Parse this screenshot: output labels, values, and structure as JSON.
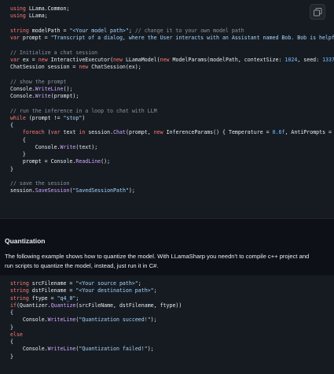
{
  "code_block_1": {
    "copy_label": "copy-icon",
    "lines": [
      [
        {
          "c": "kw",
          "t": "using"
        },
        {
          "c": "tx",
          "t": " LLama.Common;"
        }
      ],
      [
        {
          "c": "kw",
          "t": "using"
        },
        {
          "c": "tx",
          "t": " LLama;"
        }
      ],
      [],
      [
        {
          "c": "kw",
          "t": "string"
        },
        {
          "c": "tx",
          "t": " modelPath = "
        },
        {
          "c": "str",
          "t": "\"<Your model path>\""
        },
        {
          "c": "tx",
          "t": "; "
        },
        {
          "c": "cm",
          "t": "// change it to your own model path"
        }
      ],
      [
        {
          "c": "kw",
          "t": "var"
        },
        {
          "c": "tx",
          "t": " prompt = "
        },
        {
          "c": "str",
          "t": "\"Transcript of a dialog, where the User interacts with an Assistant named Bob. Bob is helpful, k"
        }
      ],
      [],
      [
        {
          "c": "cm",
          "t": "// Initialize a chat session"
        }
      ],
      [
        {
          "c": "kw",
          "t": "var"
        },
        {
          "c": "tx",
          "t": " ex = "
        },
        {
          "c": "kw",
          "t": "new"
        },
        {
          "c": "tx",
          "t": " InteractiveExecutor("
        },
        {
          "c": "kw",
          "t": "new"
        },
        {
          "c": "tx",
          "t": " LLamaModel("
        },
        {
          "c": "kw",
          "t": "new"
        },
        {
          "c": "tx",
          "t": " ModelParams(modelPath, contextSize: "
        },
        {
          "c": "num",
          "t": "1024"
        },
        {
          "c": "tx",
          "t": ", seed: "
        },
        {
          "c": "num",
          "t": "1337"
        },
        {
          "c": "tx",
          "t": ", gpu"
        }
      ],
      [
        {
          "c": "tx",
          "t": "ChatSession session = "
        },
        {
          "c": "kw",
          "t": "new"
        },
        {
          "c": "tx",
          "t": " ChatSession(ex);"
        }
      ],
      [],
      [
        {
          "c": "cm",
          "t": "// show the prompt"
        }
      ],
      [
        {
          "c": "tx",
          "t": "Console."
        },
        {
          "c": "fn",
          "t": "WriteLine"
        },
        {
          "c": "tx",
          "t": "();"
        }
      ],
      [
        {
          "c": "tx",
          "t": "Console."
        },
        {
          "c": "fn",
          "t": "Write"
        },
        {
          "c": "tx",
          "t": "(prompt);"
        }
      ],
      [],
      [
        {
          "c": "cm",
          "t": "// run the inference in a loop to chat with LLM"
        }
      ],
      [
        {
          "c": "kw",
          "t": "while"
        },
        {
          "c": "tx",
          "t": " (prompt != "
        },
        {
          "c": "str",
          "t": "\"stop\""
        },
        {
          "c": "tx",
          "t": ")"
        }
      ],
      [
        {
          "c": "tx",
          "t": "{"
        }
      ],
      [
        {
          "c": "tx",
          "t": "    "
        },
        {
          "c": "kw",
          "t": "foreach"
        },
        {
          "c": "tx",
          "t": " ("
        },
        {
          "c": "kw",
          "t": "var"
        },
        {
          "c": "tx",
          "t": " text "
        },
        {
          "c": "kw",
          "t": "in"
        },
        {
          "c": "tx",
          "t": " session."
        },
        {
          "c": "fn",
          "t": "Chat"
        },
        {
          "c": "tx",
          "t": "(prompt, "
        },
        {
          "c": "kw",
          "t": "new"
        },
        {
          "c": "tx",
          "t": " InferenceParams() { Temperature = "
        },
        {
          "c": "num",
          "t": "0.6f"
        },
        {
          "c": "tx",
          "t": ", AntiPrompts = "
        },
        {
          "c": "kw",
          "t": "new"
        },
        {
          "c": "tx",
          "t": " L"
        }
      ],
      [
        {
          "c": "tx",
          "t": "    {"
        }
      ],
      [
        {
          "c": "tx",
          "t": "        Console."
        },
        {
          "c": "fn",
          "t": "Write"
        },
        {
          "c": "tx",
          "t": "(text);"
        }
      ],
      [
        {
          "c": "tx",
          "t": "    }"
        }
      ],
      [
        {
          "c": "tx",
          "t": "    prompt = Console."
        },
        {
          "c": "fn",
          "t": "ReadLine"
        },
        {
          "c": "tx",
          "t": "();"
        }
      ],
      [
        {
          "c": "tx",
          "t": "}"
        }
      ],
      [],
      [
        {
          "c": "cm",
          "t": "// save the session"
        }
      ],
      [
        {
          "c": "tx",
          "t": "session."
        },
        {
          "c": "fn",
          "t": "SaveSession"
        },
        {
          "c": "tx",
          "t": "("
        },
        {
          "c": "str",
          "t": "\"SavedSessionPath\""
        },
        {
          "c": "tx",
          "t": ");"
        }
      ]
    ]
  },
  "section": {
    "heading": "Quantization",
    "paragraph_lines": [
      "The following example shows how to quantize the model. With LLamaSharp you needn't to compile c++ project and",
      "run scripts to quantize the model, instead, just run it in C#."
    ]
  },
  "code_block_2": {
    "lines": [
      [
        {
          "c": "kw",
          "t": "string"
        },
        {
          "c": "tx",
          "t": " srcFilename = "
        },
        {
          "c": "str",
          "t": "\"<Your source path>\""
        },
        {
          "c": "tx",
          "t": ";"
        }
      ],
      [
        {
          "c": "kw",
          "t": "string"
        },
        {
          "c": "tx",
          "t": " dstFilename = "
        },
        {
          "c": "str",
          "t": "\"<Your destination path>\""
        },
        {
          "c": "tx",
          "t": ";"
        }
      ],
      [
        {
          "c": "kw",
          "t": "string"
        },
        {
          "c": "tx",
          "t": " ftype = "
        },
        {
          "c": "str",
          "t": "\"q4_0\""
        },
        {
          "c": "tx",
          "t": ";"
        }
      ],
      [
        {
          "c": "kw",
          "t": "if"
        },
        {
          "c": "tx",
          "t": "(Quantizer."
        },
        {
          "c": "fn",
          "t": "Quantize"
        },
        {
          "c": "tx",
          "t": "(srcFileName, dstFilename, ftype))"
        }
      ],
      [
        {
          "c": "tx",
          "t": "{"
        }
      ],
      [
        {
          "c": "tx",
          "t": "    Console."
        },
        {
          "c": "fn",
          "t": "WriteLine"
        },
        {
          "c": "tx",
          "t": "("
        },
        {
          "c": "str",
          "t": "\"Quantization succeed!\""
        },
        {
          "c": "tx",
          "t": ");"
        }
      ],
      [
        {
          "c": "tx",
          "t": "}"
        }
      ],
      [
        {
          "c": "kw",
          "t": "else"
        }
      ],
      [
        {
          "c": "tx",
          "t": "{"
        }
      ],
      [
        {
          "c": "tx",
          "t": "    Console."
        },
        {
          "c": "fn",
          "t": "WriteLine"
        },
        {
          "c": "tx",
          "t": "("
        },
        {
          "c": "str",
          "t": "\"Quantization failed!\""
        },
        {
          "c": "tx",
          "t": ");"
        }
      ],
      [
        {
          "c": "tx",
          "t": "}"
        }
      ]
    ]
  },
  "colors": {
    "page_bg": "#0d1117",
    "code_bg": "#161b22",
    "keyword": "#ff7b72",
    "string": "#a5d6ff",
    "number": "#79c0ff",
    "method": "#d2a8ff",
    "comment": "#8b949e",
    "text": "#e6edf3"
  }
}
